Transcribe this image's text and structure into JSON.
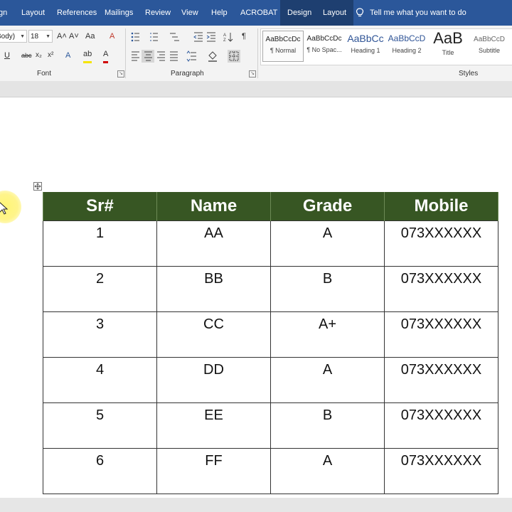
{
  "tabs": [
    {
      "label": "gn"
    },
    {
      "label": "Layout"
    },
    {
      "label": "References"
    },
    {
      "label": "Mailings"
    },
    {
      "label": "Review"
    },
    {
      "label": "View"
    },
    {
      "label": "Help"
    },
    {
      "label": "ACROBAT"
    },
    {
      "label": "Design"
    },
    {
      "label": "Layout"
    }
  ],
  "tell_me": "Tell me what you want to do",
  "ribbon": {
    "font": {
      "name": "Body)",
      "size": "18",
      "grow": "A˄",
      "shrink": "A˅",
      "case": "Aa",
      "clear": "A",
      "underline": "U",
      "strikethrough": "abc",
      "subscript": "x₂",
      "superscript": "x²",
      "effects": "A",
      "highlight": "ab",
      "color": "A",
      "label": "Font"
    },
    "paragraph": {
      "pilcrow": "¶",
      "label": "Paragraph"
    },
    "styles": {
      "label": "Styles",
      "items": [
        {
          "sample": "AaBbCcDc",
          "name": "¶ Normal"
        },
        {
          "sample": "AaBbCcDc",
          "name": "¶ No Spac..."
        },
        {
          "sample": "AaBbCc",
          "name": "Heading 1"
        },
        {
          "sample": "AaBbCcD",
          "name": "Heading 2"
        },
        {
          "sample": "AaB",
          "name": "Title"
        },
        {
          "sample": "AaBbCcD",
          "name": "Subtitle"
        }
      ]
    }
  },
  "colors": {
    "tabbar": "#2b579a",
    "table_header": "#375623",
    "accent_blue": "#2b579a"
  },
  "table": {
    "headers": [
      "Sr#",
      "Name",
      "Grade",
      "Mobile"
    ],
    "rows": [
      [
        "1",
        "AA",
        "A",
        "073XXXXXX"
      ],
      [
        "2",
        "BB",
        "B",
        "073XXXXXX"
      ],
      [
        "3",
        "CC",
        "A+",
        "073XXXXXX"
      ],
      [
        "4",
        "DD",
        "A",
        "073XXXXXX"
      ],
      [
        "5",
        "EE",
        "B",
        "073XXXXXX"
      ],
      [
        "6",
        "FF",
        "A",
        "073XXXXXX"
      ]
    ]
  },
  "icons": [
    "lightbulb-icon",
    "table-move-handle-icon",
    "mouse-pointer-icon",
    "bullets-icon",
    "numbering-icon",
    "multilevel-list-icon",
    "sort-icon",
    "align-left-icon",
    "align-center-icon",
    "align-right-icon",
    "justify-icon",
    "shading-icon",
    "borders-icon"
  ]
}
